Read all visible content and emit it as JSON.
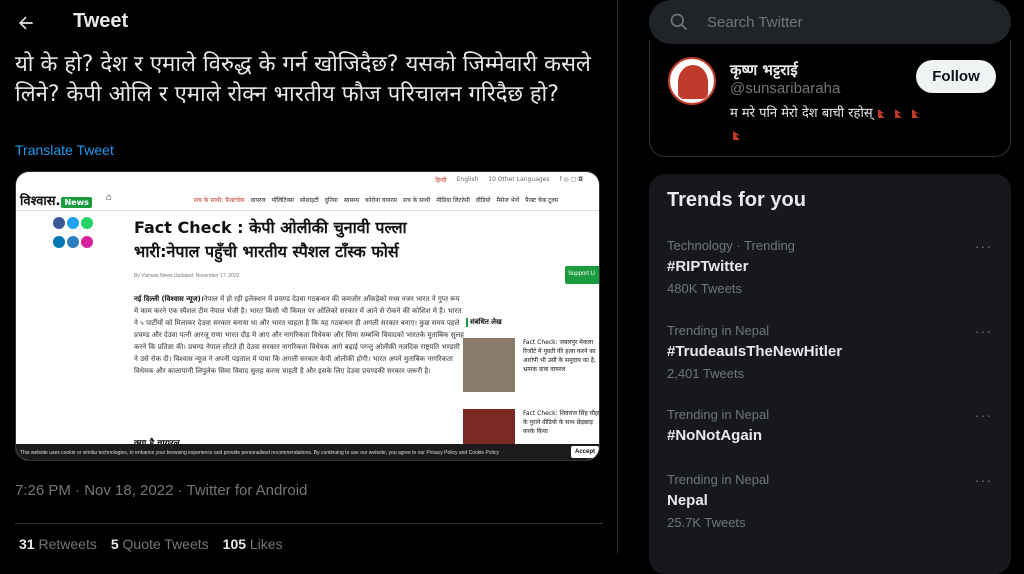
{
  "header": {
    "title": "Tweet"
  },
  "tweet": {
    "text": "यो के हो? देश र एमाले विरुद्ध के गर्न खोजिदैछ? यसको जिम्मेवारी कसले लिने? केपी ओलि र एमाले रोक्न भारतीय फौज परिचालन गरिदैछ हो?",
    "translate": "Translate Tweet",
    "meta": "7:26 PM · Nov 18, 2022 · Twitter for Android",
    "stats": {
      "retweets_count": "31",
      "retweets_label": "Retweets",
      "quotes_count": "5",
      "quotes_label": "Quote Tweets",
      "likes_count": "105",
      "likes_label": "Likes"
    }
  },
  "media": {
    "top_links": [
      "हिन्दी",
      "English",
      "10 Other Languages"
    ],
    "logo": "विश्वास.",
    "logo_badge": "News",
    "nav": [
      "सच के साथी: फैक्टचेक",
      "वायरल",
      "पॉलिटिक्स",
      "सोशाइटी",
      "दुनिया",
      "स्वास्थ्य",
      "कोरोना वायरस",
      "सच के साथी",
      "मीडिया लिटरेसी",
      "वीडियो",
      "मैसेज भेजें",
      "फैक्ट चेक टूल्स"
    ],
    "headline": "Fact Check : केपी ओलीकी चुनावी पल्ला भारी:नेपाल पहुँची भारतीय स्पैशल टाँस्क फोर्स",
    "byline": "By Vishvas News    Updated: November 17, 2022",
    "body_lead": "नई दिल्ली (विश्वास न्यूज)।",
    "body": "नेपाल में हो रही इलेक्शन में प्रचण्ड देउवा गठबन्धन की कमजोर आँकड़ेको मध्य नजर भारत ने गुप्त रूप मे काम करने एक स्पैशल टीम नेपाल भेजी है। भारत किसी भी किमत पर ओलिको सरकार में आने से रोकने की कोशिश मे है। भारत ने ५ पार्टीयों को मिलाकर देउवा सरकार बनाया था और भारत चाहता है कि यह गठबन्धन ही अगली सरकार बनाए। कुछ समय पहले प्रचण्ड और देउवा पत्नी आरजू राणा भारत दौड़ मे आए और नागरिकता विधेयक और सिमा सम्बन्धि विवादको भारतके मुताबिक सुलह करने कि प्रतिज्ञा की। प्रचण्ड नेपाल लौटते ही देउवा सरकार नागरिकता विधेयक आगे बढ़ाई परन्तु ओलीकी नजदिक राष्ट्रपति भण्डारी ने उसे रोक दी। विश्वास न्यूज ने अपनी पड़ताल मे पाया कि अगली सरकार केपी ओलीकी होगी। भारत अपने मुताबिक नागरिकता विधेयक और कालापानी लिपुलेक सिमा विवाद सुलह करना चाहती है और इसके लिए देउवा प्रचण्डकी सरकार जरूरी है।",
    "subhead": "क्या है वायरल",
    "support": "Support U",
    "related_title": "संबंधित लेख",
    "related": [
      "Fact Check: जबलपुर मेकला रिजॉर्ट में युवती की हत्या करने का आरोपी भी उसी के समुदाय का है, भ्रामक दावा वायरल",
      "Fact Check: शिवराज सिंह चौहान के पुराने वीडियो के साथ छेड़छाड़ करके किया"
    ],
    "cookie": "This website uses cookie or similar technologies, to enhance your browsing experience and provide personalised recommendations. By continuing to use our website, you agree to our Privacy Policy and Cookie Policy",
    "accept": "Accept"
  },
  "search": {
    "placeholder": "Search Twitter"
  },
  "profile": {
    "name": "कृष्ण भट्टराई",
    "handle": "@sunsaribaraha",
    "bio": "म मरे पनि मेरो देश बाची रहोस्",
    "follow": "Follow"
  },
  "trends": {
    "title": "Trends for you",
    "items": [
      {
        "context": "Technology · Trending",
        "name": "#RIPTwitter",
        "count": "480K Tweets"
      },
      {
        "context": "Trending in Nepal",
        "name": "#TrudeauIsTheNewHitler",
        "count": "2,401 Tweets"
      },
      {
        "context": "Trending in Nepal",
        "name": "#NoNotAgain",
        "count": ""
      },
      {
        "context": "Trending in Nepal",
        "name": "Nepal",
        "count": "25.7K Tweets"
      }
    ],
    "more": "···"
  }
}
